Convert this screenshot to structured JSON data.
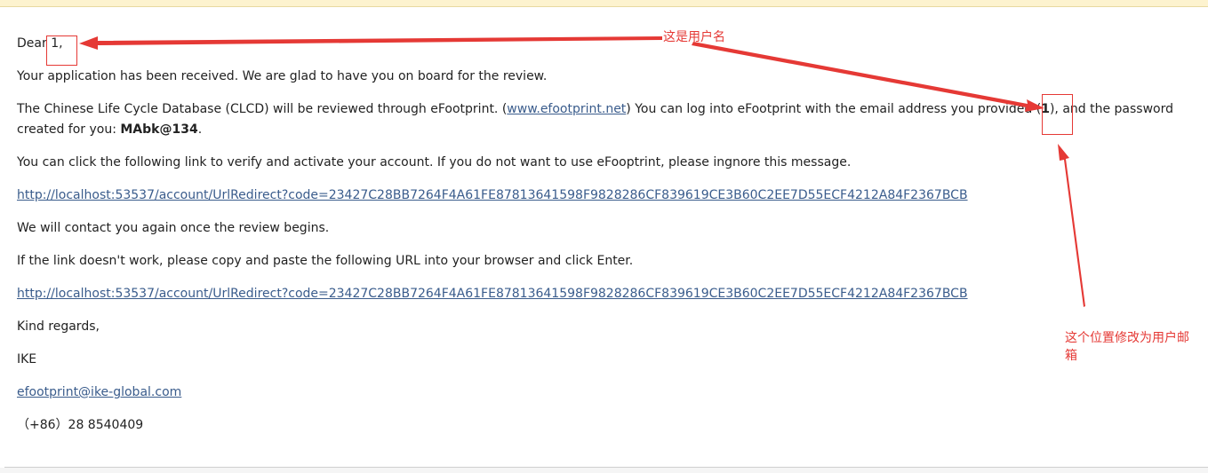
{
  "email": {
    "greeting_prefix": "Dear",
    "username": "1,",
    "received": "Your application has been received. We are glad to have you on board for the review.",
    "review_part1": "The Chinese Life Cycle Database (CLCD) will be reviewed through eFootprint. (",
    "site_link": "www.efootprint.net",
    "review_part2": ") You can log into eFootprint with the email address you provided (",
    "email_placeholder": "1",
    "review_part3": "), and the password",
    "password_prefix": "created for you: ",
    "password": "MAbk@134",
    "password_suffix": ".",
    "verify_text": "You can click the following link to verify and activate your account. If you do not want to use eFooptrint, please ingnore this message.",
    "verify_link": "http://localhost:53537/account/UrlRedirect?code=23427C28BB7264F4A61FE87813641598F9828286CF839619CE3B60C2EE7D55ECF4212A84F2367BCB",
    "contact_text": "We will contact you again once the review begins.",
    "fallback_text": "If the link doesn't work, please copy and paste the following URL into your browser and click Enter.",
    "fallback_link": "http://localhost:53537/account/UrlRedirect?code=23427C28BB7264F4A61FE87813641598F9828286CF839619CE3B60C2EE7D55ECF4212A84F2367BCB",
    "closing": "Kind regards,",
    "signature_name": "IKE",
    "signature_email": "efootprint@ike-global.com",
    "signature_phone": "（+86）28 8540409"
  },
  "annotations": {
    "username_note": "这是用户名",
    "email_note_line1": "这个位置修改为用户邮",
    "email_note_line2": "箱",
    "color": "#e53935"
  }
}
